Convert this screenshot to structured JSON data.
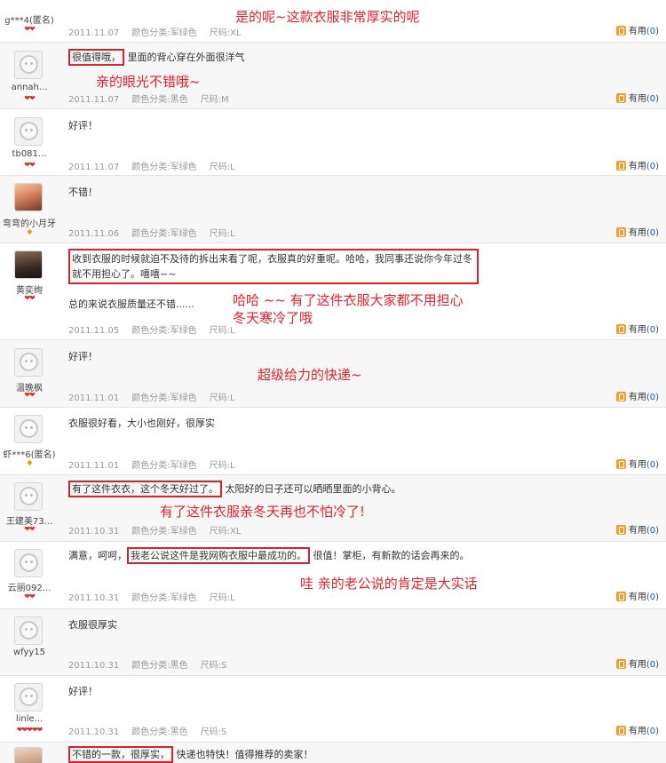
{
  "useful_label": "有用",
  "rows": [
    {
      "user": "g***4(匿名)",
      "text": "",
      "date": "2011.11.07",
      "color": "颜色分类:军绿色",
      "size": "尺码:XL",
      "count": "(0)",
      "anno": "是的呢~这款衣服非常厚实的呢"
    },
    {
      "user": "annah...",
      "text_boxed": "很值得哦，",
      "text_rest": "里面的背心穿在外面很洋气",
      "date": "2011.11.07",
      "color": "颜色分类:黑色",
      "size": "尺码:M",
      "count": "(0)",
      "anno": "亲的眼光不错哦~"
    },
    {
      "user": "tb081...",
      "text": "好评！",
      "date": "2011.11.07",
      "color": "颜色分类:军绿色",
      "size": "尺码:L",
      "count": "(0)"
    },
    {
      "user": "弯弯的小月牙",
      "text": "不错！",
      "date": "2011.11.06",
      "color": "颜色分类:军绿色",
      "size": "尺码:L",
      "count": "(0)"
    },
    {
      "user": "黄奕绚",
      "text_boxed": "收到衣服的时候就迫不及待的拆出来看了呢，衣服真的好重呢。哈哈，我同事还说你今年过冬就不用担心了。嘻嘻~~",
      "text2": "总的来说衣服质量还不错......",
      "date": "2011.11.05",
      "color": "颜色分类:军绿色",
      "size": "尺码:L",
      "count": "(0)",
      "anno": "哈哈 ~~  有了这件衣服大家都不用担心",
      "anno2": "冬天寒冷了哦"
    },
    {
      "user": "温晚枫",
      "text": "好评！",
      "date": "2011.11.01",
      "color": "颜色分类:军绿色",
      "size": "尺码:L",
      "count": "(0)",
      "anno": "超级给力的快递~"
    },
    {
      "user": "虾***6(匿名)",
      "text": "衣服很好看，大小也刚好，很厚实",
      "date": "2011.11.01",
      "color": "颜色分类:军绿色",
      "size": "尺码:L",
      "count": "(0)"
    },
    {
      "user": "王建美73...",
      "text_boxed": "有了这件衣衣，这个冬天好过了。",
      "text_rest": "太阳好的日子还可以晒晒里面的小背心。",
      "date": "2011.10.31",
      "color": "颜色分类:军绿色",
      "size": "尺码:XL",
      "count": "(0)",
      "anno": "有了这件衣服亲冬天再也不怕冷了!"
    },
    {
      "user": "云丽092...",
      "text_pre": "满意，呵呵，",
      "text_boxed": "我老公说这件是我网购衣服中最成功的。",
      "text_rest": "很值！掌柜，有新款的话会再来的。",
      "date": "2011.10.31",
      "color": "颜色分类:军绿色",
      "size": "尺码:L",
      "count": "(0)",
      "anno": "哇  亲的老公说的肯定是大实话"
    },
    {
      "user": "wfyy15",
      "text": "衣服很厚实",
      "date": "2011.10.31",
      "color": "颜色分类:黑色",
      "size": "尺码:S",
      "count": "(0)"
    },
    {
      "user": "linle...",
      "text": "好评！",
      "date": "2011.10.31",
      "color": "颜色分类:黑色",
      "size": "尺码:S",
      "count": "(0)"
    },
    {
      "user": "",
      "text_boxed": "不错的一款，很厚实，",
      "text_rest": "快递也特快！值得推荐的卖家！"
    }
  ]
}
